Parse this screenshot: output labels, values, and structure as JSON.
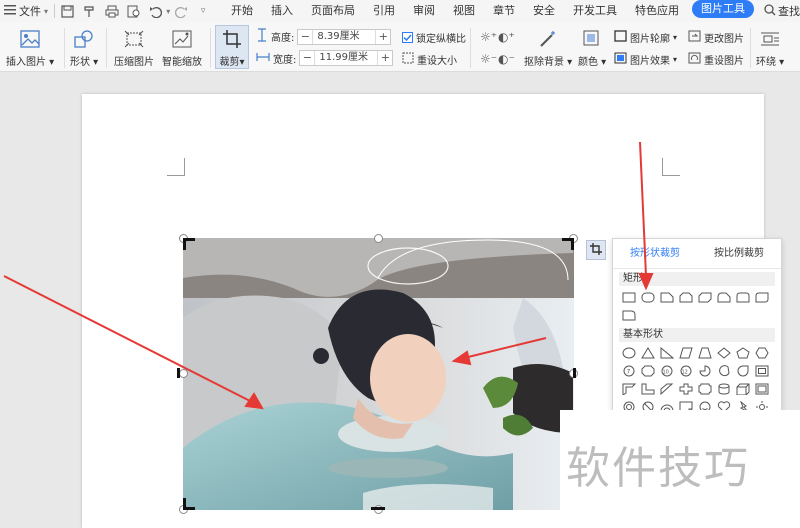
{
  "menubar": {
    "file_label": "文件",
    "tabs": [
      {
        "label": "开始"
      },
      {
        "label": "插入"
      },
      {
        "label": "页面布局"
      },
      {
        "label": "引用"
      },
      {
        "label": "审阅"
      },
      {
        "label": "视图"
      },
      {
        "label": "章节"
      },
      {
        "label": "安全"
      },
      {
        "label": "开发工具"
      },
      {
        "label": "特色应用"
      },
      {
        "label": "图片工具"
      }
    ],
    "search_label": "查找"
  },
  "ribbon": {
    "insert_picture": "插入图片",
    "shape": "形状",
    "compress": "压缩图片",
    "smart_scale": "智能缩放",
    "crop": "裁剪",
    "height_label": "高度:",
    "height_value": "8.39厘米",
    "width_label": "宽度:",
    "width_value": "11.99厘米",
    "lock_ratio": "锁定纵横比",
    "reset_size": "重设大小",
    "remove_bg": "抠除背景",
    "color": "颜色",
    "outline": "图片轮廓",
    "effects": "图片效果",
    "change_picture": "更改图片",
    "reset_picture": "重设图片",
    "wrap": "环绕"
  },
  "crop_panel": {
    "tab_shape": "按形状裁剪",
    "tab_ratio": "按比例裁剪",
    "section_rect": "矩形",
    "section_basic": "基本形状"
  },
  "watermark": "软件技巧",
  "colors": {
    "accent": "#2f7df6",
    "arrow": "#e53935"
  }
}
